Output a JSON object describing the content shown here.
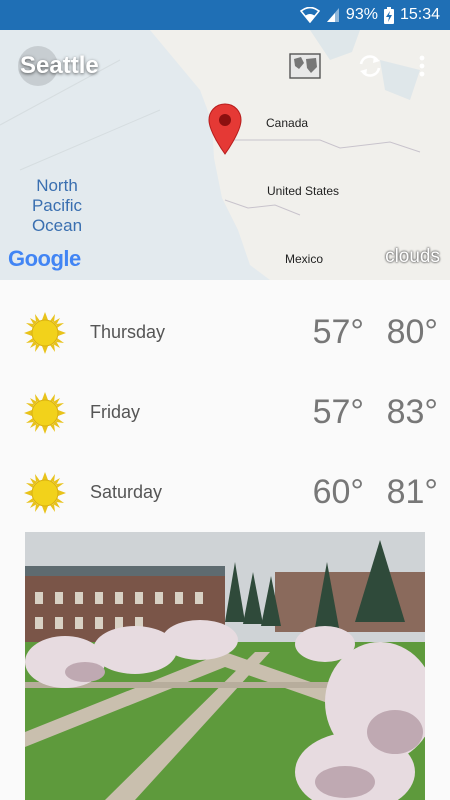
{
  "status_bar": {
    "battery": "93%",
    "time": "15:34",
    "background_color": "#1f6fb5"
  },
  "toolbar": {
    "city": "Seattle",
    "icons": [
      "map-icon",
      "refresh-icon",
      "more-vert-icon"
    ]
  },
  "map": {
    "labels": {
      "canada": "Canada",
      "united_states": "United States",
      "mexico": "Mexico"
    },
    "ocean_lines": [
      "North",
      "Pacific",
      "Ocean"
    ],
    "layer_label": "clouds",
    "google_logo": "Google"
  },
  "forecast": [
    {
      "day": "Thursday",
      "low": "57°",
      "high": "80°",
      "icon": "sun-icon"
    },
    {
      "day": "Friday",
      "low": "57°",
      "high": "83°",
      "icon": "sun-icon"
    },
    {
      "day": "Saturday",
      "low": "60°",
      "high": "81°",
      "icon": "sun-icon"
    }
  ],
  "colors": {
    "sun": "#f2d21b",
    "temperature_text": "#777777",
    "day_text": "#555555",
    "pin": "#e53935"
  }
}
